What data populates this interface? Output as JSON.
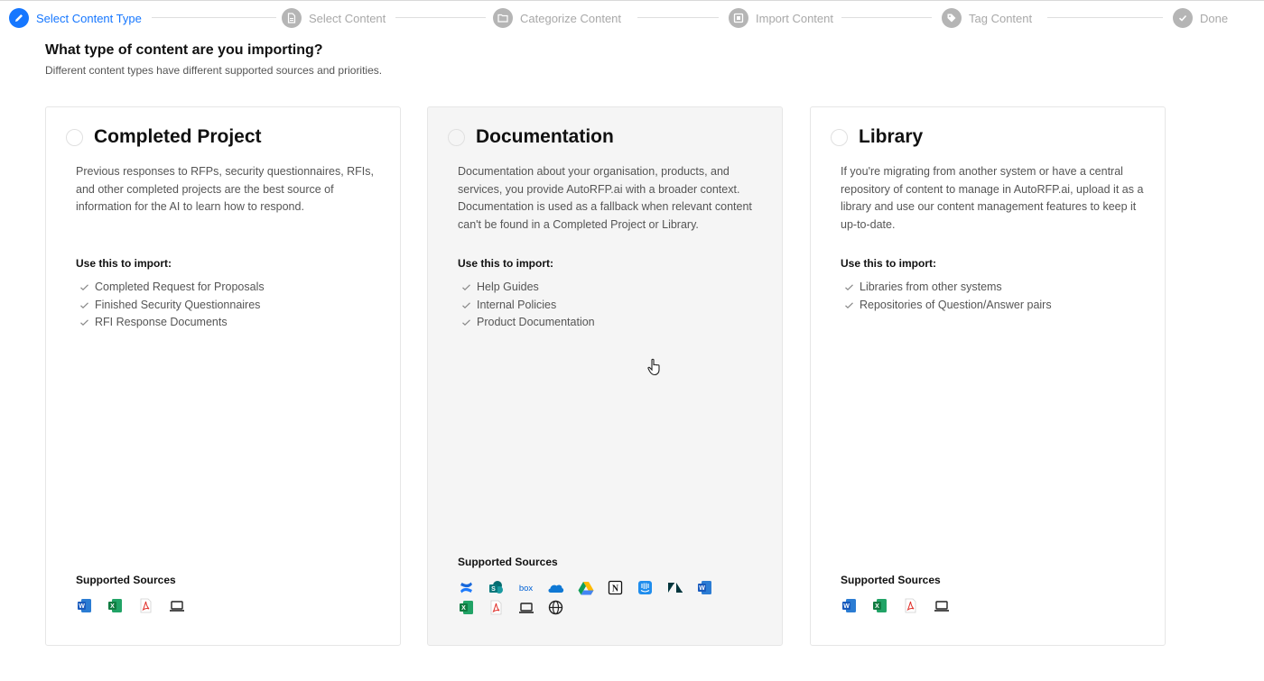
{
  "stepper": {
    "steps": [
      {
        "label": "Select Content Type",
        "state": "active",
        "icon": "pencil-icon"
      },
      {
        "label": "Select Content",
        "state": "pending",
        "icon": "document-icon"
      },
      {
        "label": "Categorize Content",
        "state": "pending",
        "icon": "folder-icon"
      },
      {
        "label": "Import Content",
        "state": "pending",
        "icon": "import-icon"
      },
      {
        "label": "Tag Content",
        "state": "pending",
        "icon": "tag-icon"
      },
      {
        "label": "Done",
        "state": "pending",
        "icon": "check-icon"
      }
    ],
    "colors": {
      "active": "#1677ff",
      "pending": "#b5b5b5"
    }
  },
  "page": {
    "heading": "What type of content are you importing?",
    "subheading": "Different content types have different supported sources and priorities."
  },
  "cards": [
    {
      "title": "Completed Project",
      "description": "Previous responses to RFPs, security questionnaires, RFIs, and other completed projects are the best source of information for the AI to learn how to respond.",
      "use_title": "Use this to import:",
      "items": [
        "Completed Request for Proposals",
        "Finished Security Questionnaires",
        "RFI Response Documents"
      ],
      "sources_title": "Supported Sources",
      "sources": [
        "word-icon",
        "excel-icon",
        "pdf-icon",
        "laptop-icon"
      ]
    },
    {
      "title": "Documentation",
      "description": "Documentation about your organisation, products, and services, you provide AutoRFP.ai with a broader context. Documentation is used as a fallback when relevant content can't be found in a Completed Project or Library.",
      "use_title": "Use this to import:",
      "items": [
        "Help Guides",
        "Internal Policies",
        "Product Documentation"
      ],
      "sources_title": "Supported Sources",
      "sources": [
        "confluence-icon",
        "sharepoint-icon",
        "box-icon",
        "onedrive-icon",
        "google-drive-icon",
        "notion-icon",
        "intercom-icon",
        "zendesk-icon",
        "word-icon",
        "excel-icon",
        "pdf-icon",
        "laptop-icon",
        "globe-icon"
      ],
      "box_text": "box"
    },
    {
      "title": "Library",
      "description": "If you're migrating from another system or have a central repository of content to manage in AutoRFP.ai, upload it as a library and use our content management features to keep it up-to-date.",
      "use_title": "Use this to import:",
      "items": [
        "Libraries from other systems",
        "Repositories of Question/Answer pairs"
      ],
      "sources_title": "Supported Sources",
      "sources": [
        "word-icon",
        "excel-icon",
        "pdf-icon",
        "laptop-icon"
      ]
    }
  ]
}
